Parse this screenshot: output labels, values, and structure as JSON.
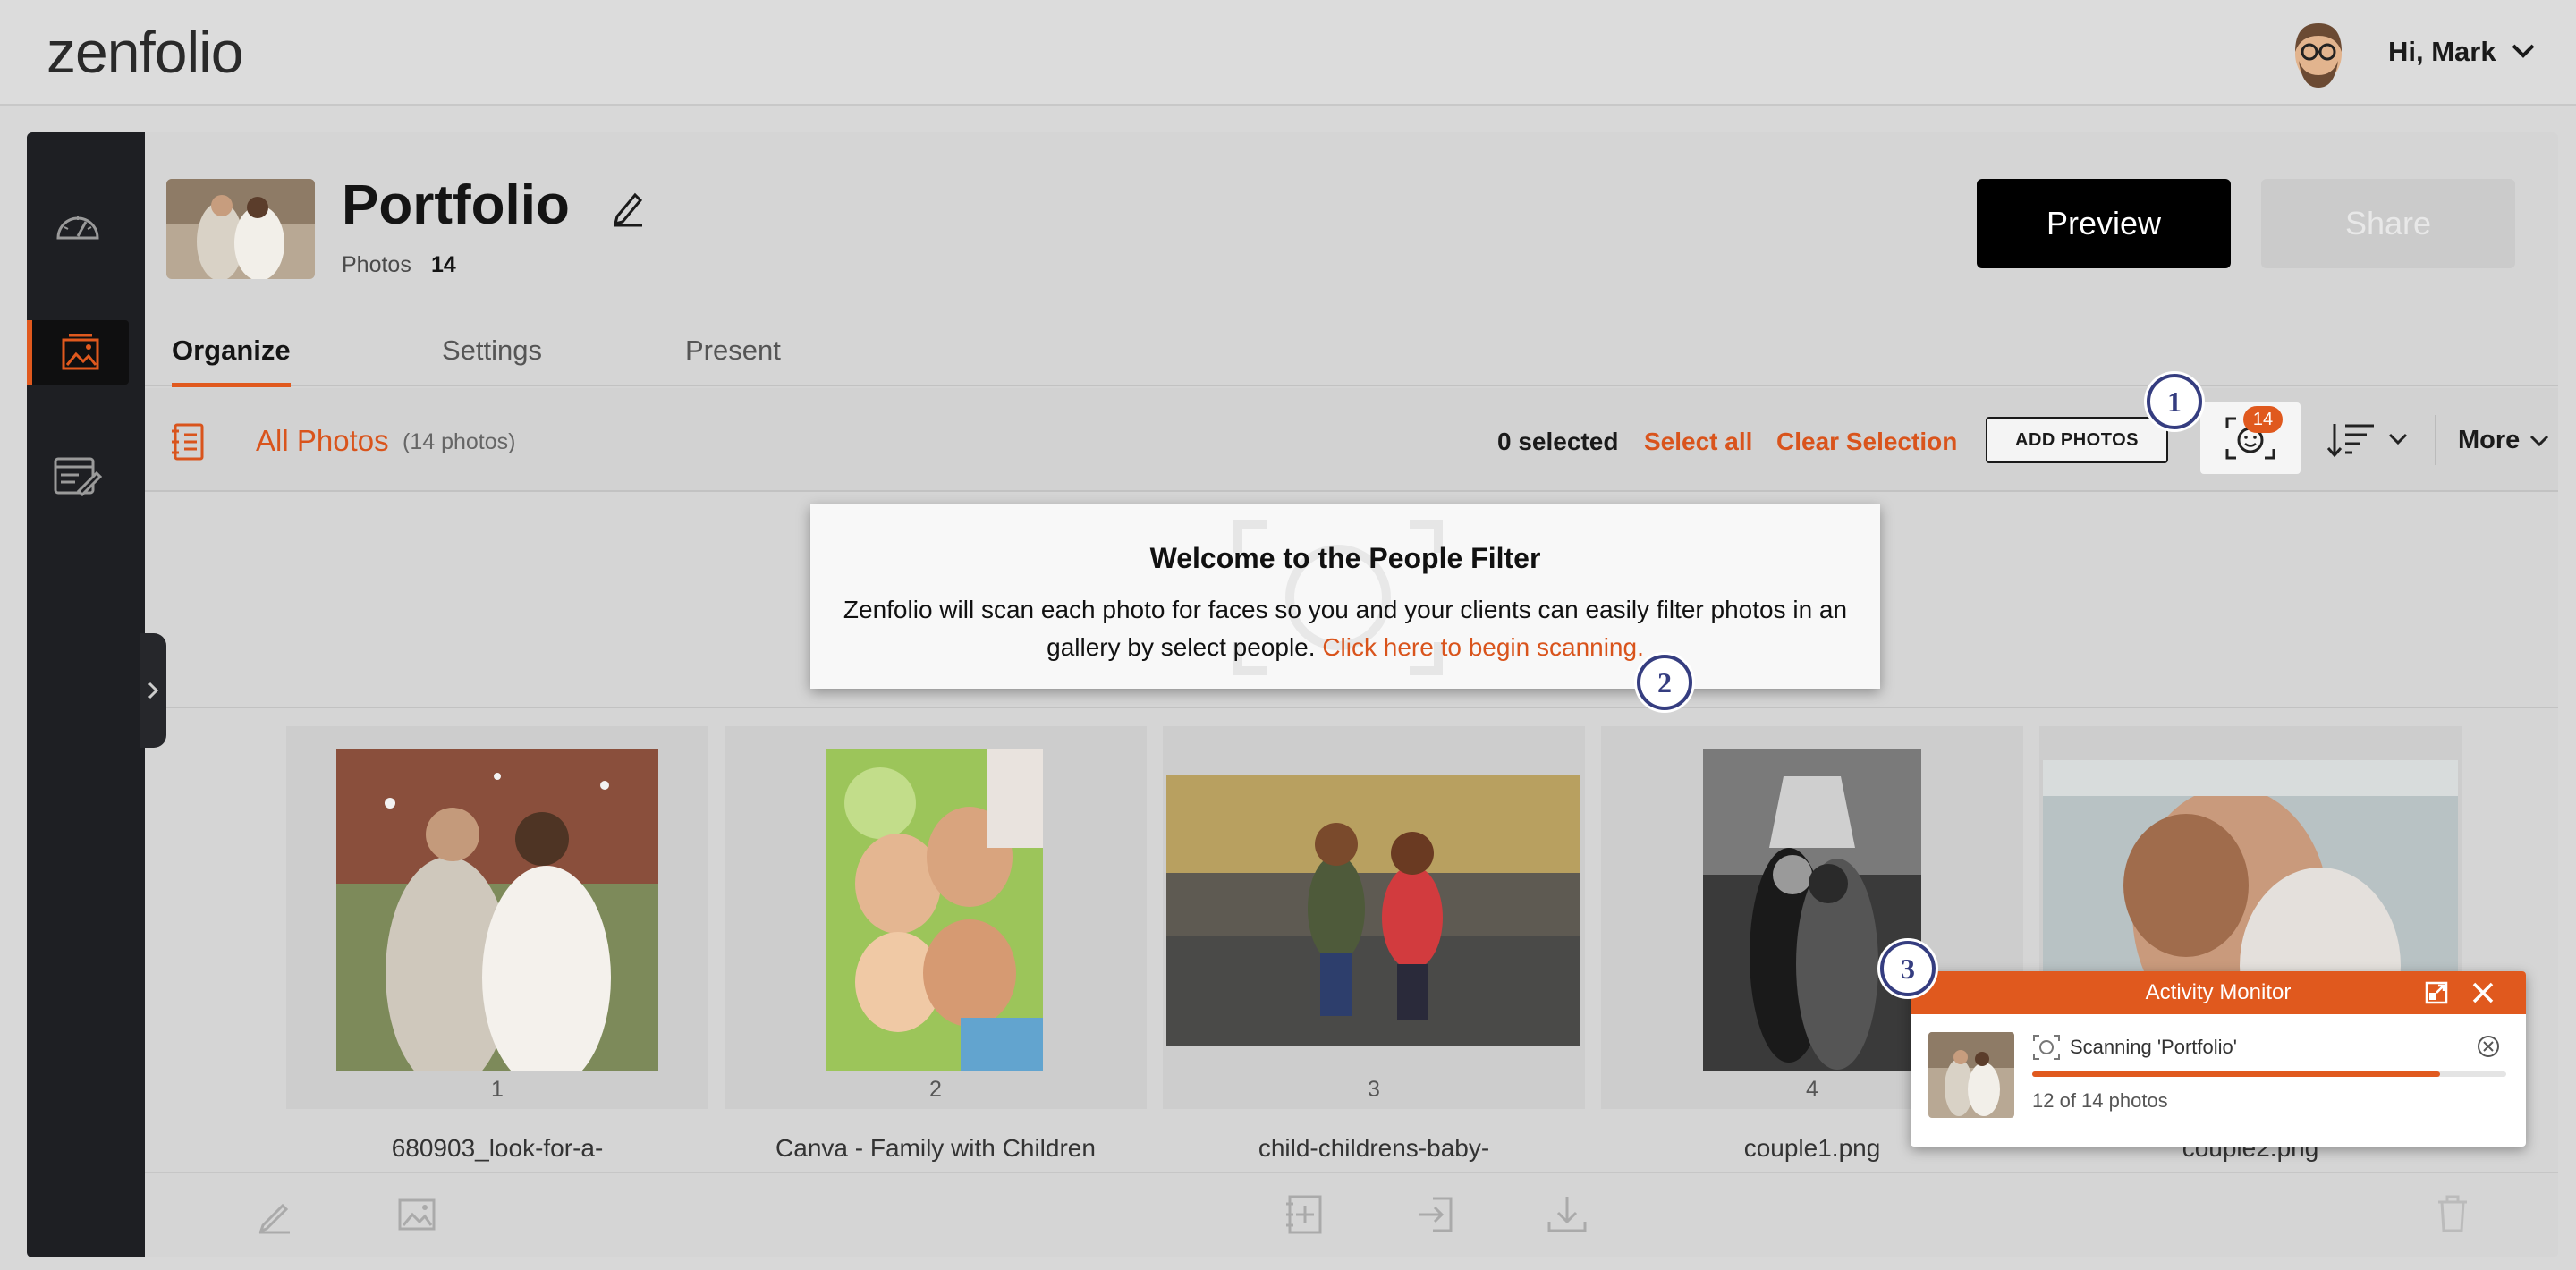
{
  "brand": {
    "logo": "zenfolio",
    "accent": "#e0591e"
  },
  "user": {
    "greeting": "Hi, Mark"
  },
  "gallery": {
    "title": "Portfolio",
    "photos_label": "Photos",
    "photos_count": "14"
  },
  "actions": {
    "preview": "Preview",
    "share": "Share"
  },
  "tabs": [
    {
      "label": "Organize"
    },
    {
      "label": "Settings"
    },
    {
      "label": "Present"
    }
  ],
  "toolbar": {
    "all_photos": "All Photos",
    "all_photos_count": "(14 photos)",
    "selected": "0 selected",
    "select_all": "Select all",
    "clear_selection": "Clear Selection",
    "add_photos": "ADD PHOTOS",
    "people_badge": "14",
    "more": "More"
  },
  "welcome": {
    "title": "Welcome to the People Filter",
    "text": "Zenfolio will scan each photo for faces so you and your clients can easily filter photos in an gallery by select people.",
    "link": "Click here to begin scanning."
  },
  "steps": [
    "1",
    "2",
    "3"
  ],
  "photos": [
    {
      "num": "1",
      "name": "680903_look-for-a-"
    },
    {
      "num": "2",
      "name": "Canva - Family with Children"
    },
    {
      "num": "3",
      "name": "child-childrens-baby-"
    },
    {
      "num": "4",
      "name": "couple1.png"
    },
    {
      "num": "",
      "name": "couple2.png"
    }
  ],
  "activity": {
    "title": "Activity Monitor",
    "scanning": "Scanning 'Portfolio'",
    "progress_text": "12 of 14 photos",
    "progress_fraction": 0.86
  },
  "icons": {
    "sidebar": [
      "dashboard-gauge-icon",
      "gallery-image-icon",
      "website-edit-icon"
    ],
    "bottombar": [
      "pencil-icon",
      "image-icon",
      "add-gallery-icon",
      "move-icon",
      "download-icon",
      "trash-icon"
    ]
  }
}
